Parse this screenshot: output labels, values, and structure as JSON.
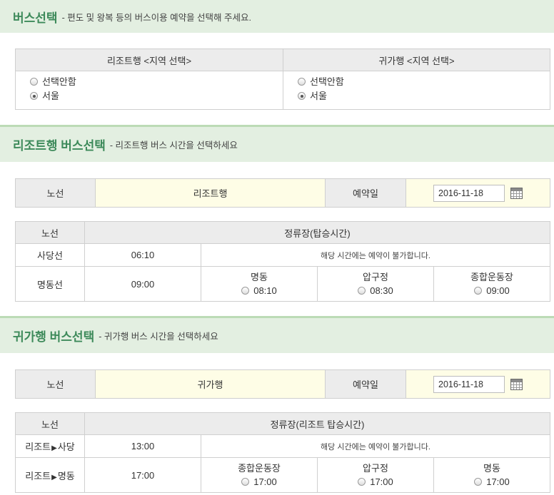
{
  "sec1": {
    "title": "버스선택",
    "desc": "- 편도 및 왕복 등의 버스이용 예약을 선택해 주세요."
  },
  "region": {
    "resort_header": "리조트행 <지역 선택>",
    "return_header": "귀가행 <지역 선택>",
    "opt_none": "선택안함",
    "opt_seoul": "서울"
  },
  "sec2": {
    "title": "리조트행 버스선택",
    "desc": "- 리조트행 버스 시간을 선택하세요"
  },
  "to_resort": {
    "route_label": "노선",
    "route_value": "리조트행",
    "date_label": "예약일",
    "date_value": "2016-11-18",
    "col_route": "노선",
    "col_stops": "정류장(탑승시간)",
    "rows": [
      {
        "route": "사당선",
        "time": "06:10",
        "note": "해당 시간에는 예약이 불가합니다."
      },
      {
        "route": "명동선",
        "time": "09:00",
        "stops": [
          {
            "name": "명동",
            "time": "08:10"
          },
          {
            "name": "압구정",
            "time": "08:30"
          },
          {
            "name": "종합운동장",
            "time": "09:00"
          }
        ]
      }
    ]
  },
  "sec3": {
    "title": "귀가행 버스선택",
    "desc": "- 귀가행 버스 시간을 선택하세요"
  },
  "to_home": {
    "route_label": "노선",
    "route_value": "귀가행",
    "date_label": "예약일",
    "date_value": "2016-11-18",
    "col_route": "노선",
    "col_stops": "정류장(리조트 탑승시간)",
    "rows": [
      {
        "from": "리조트",
        "arrow": "▶",
        "to": "사당",
        "time": "13:00",
        "note": "해당 시간에는 예약이 불가합니다."
      },
      {
        "from": "리조트",
        "arrow": "▶",
        "to": "명동",
        "time": "17:00",
        "stops": [
          {
            "name": "종합운동장",
            "time": "17:00"
          },
          {
            "name": "압구정",
            "time": "17:00"
          },
          {
            "name": "명동",
            "time": "17:00"
          }
        ]
      }
    ]
  },
  "colors": {
    "accent": "#3d8a5a",
    "section_bg": "#e3efe1",
    "header_bg": "#ececec",
    "highlight_bg": "#fefde6"
  }
}
